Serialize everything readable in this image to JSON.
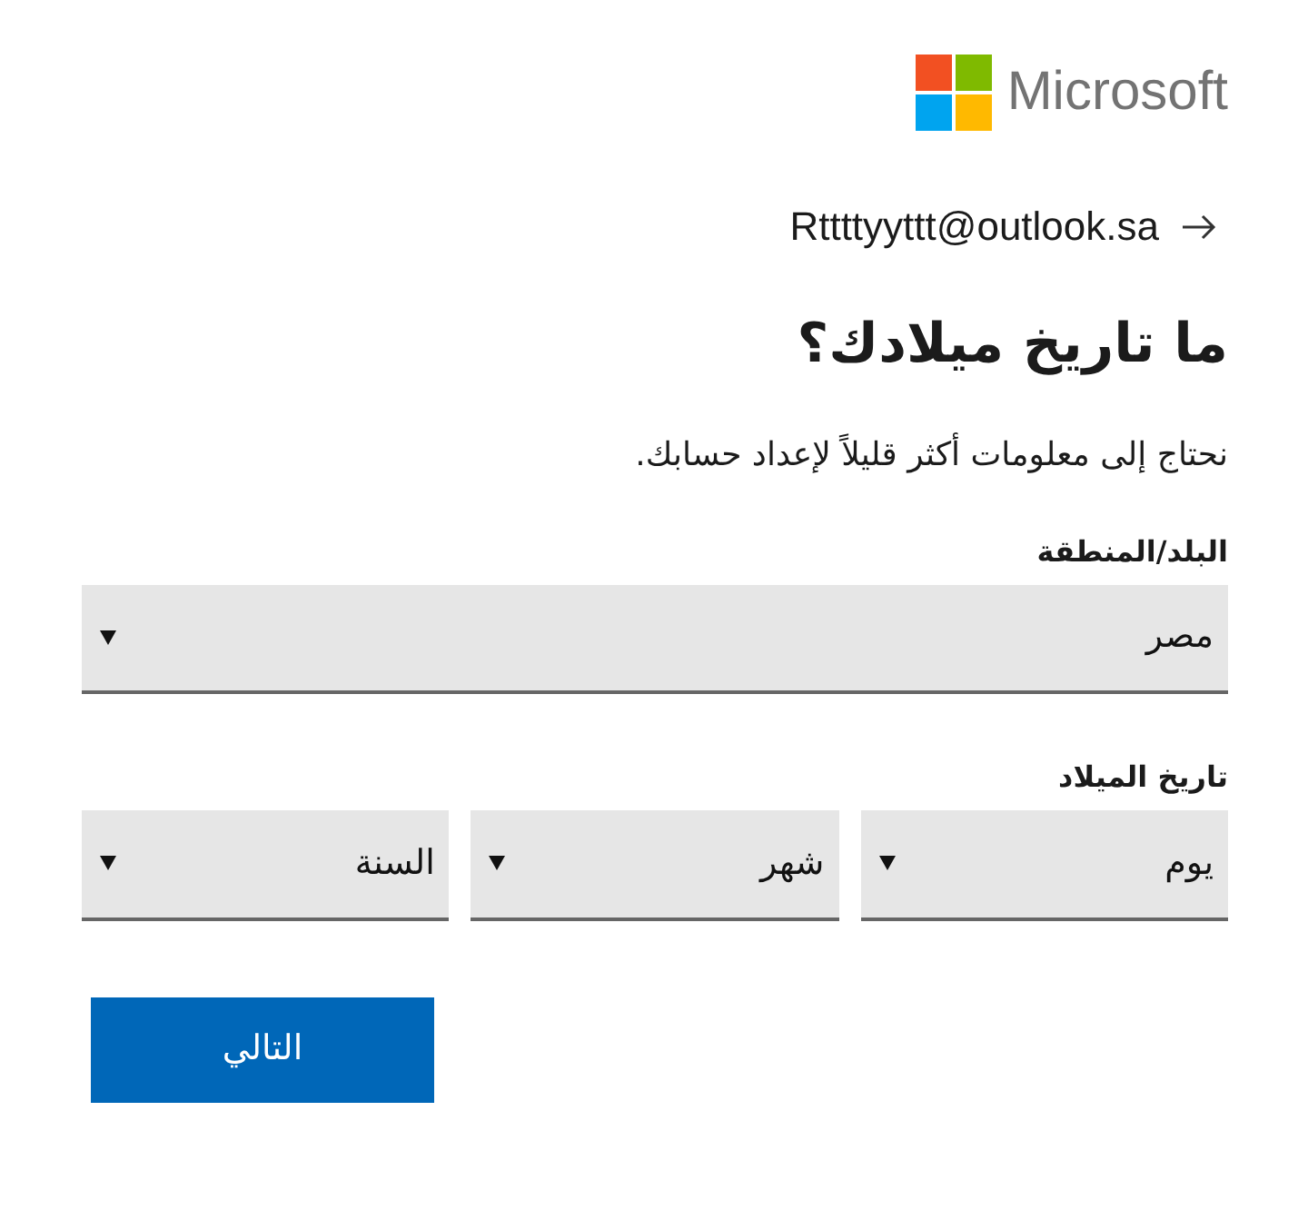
{
  "logo": {
    "text": "Microsoft"
  },
  "identity": {
    "email": "Rttttyyttt@outlook.sa"
  },
  "heading": "ما تاريخ ميلادك؟",
  "subtitle": "نحتاج إلى معلومات أكثر قليلاً لإعداد حسابك.",
  "country": {
    "label": "البلد/المنطقة",
    "value": "مصر"
  },
  "birthdate": {
    "label": "تاريخ الميلاد",
    "selects": [
      {
        "value": "يوم"
      },
      {
        "value": "شهر"
      },
      {
        "value": "السنة"
      }
    ]
  },
  "next_button": "التالي"
}
